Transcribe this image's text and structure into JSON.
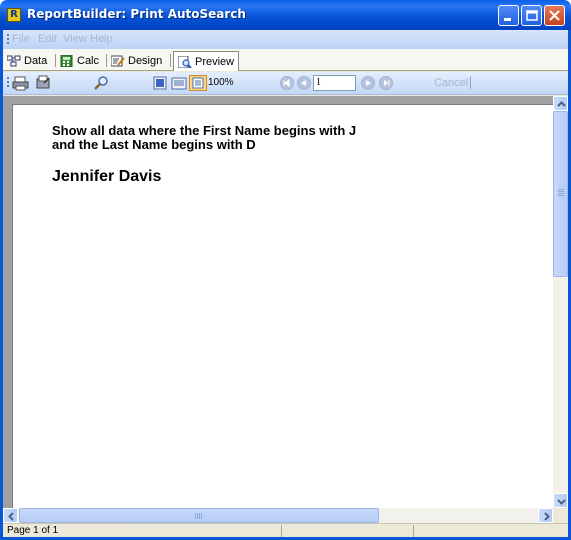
{
  "window": {
    "title": "ReportBuilder: Print AutoSearch",
    "app_icon_letter": "R"
  },
  "menu": {
    "items": [
      "File",
      "Edit",
      "View",
      "Help"
    ]
  },
  "tabs": [
    {
      "label": "Data",
      "icon": "data-icon"
    },
    {
      "label": "Calc",
      "icon": "calc-icon"
    },
    {
      "label": "Design",
      "icon": "design-icon"
    },
    {
      "label": "Preview",
      "icon": "preview-icon",
      "active": true
    }
  ],
  "toolbar": {
    "zoom": "100%",
    "page_number": "1",
    "cancel_label": "Cancel"
  },
  "report": {
    "criteria_line1": "Show all data where the First Name begins with J",
    "criteria_line2": "and the Last Name begins with D",
    "result_name": "Jennifer Davis"
  },
  "status": {
    "page_text": "Page 1 of 1"
  },
  "colors": {
    "title_bar": "#0752d6",
    "window_face": "#ece9d8",
    "preview_background": "#a0a0a0"
  }
}
